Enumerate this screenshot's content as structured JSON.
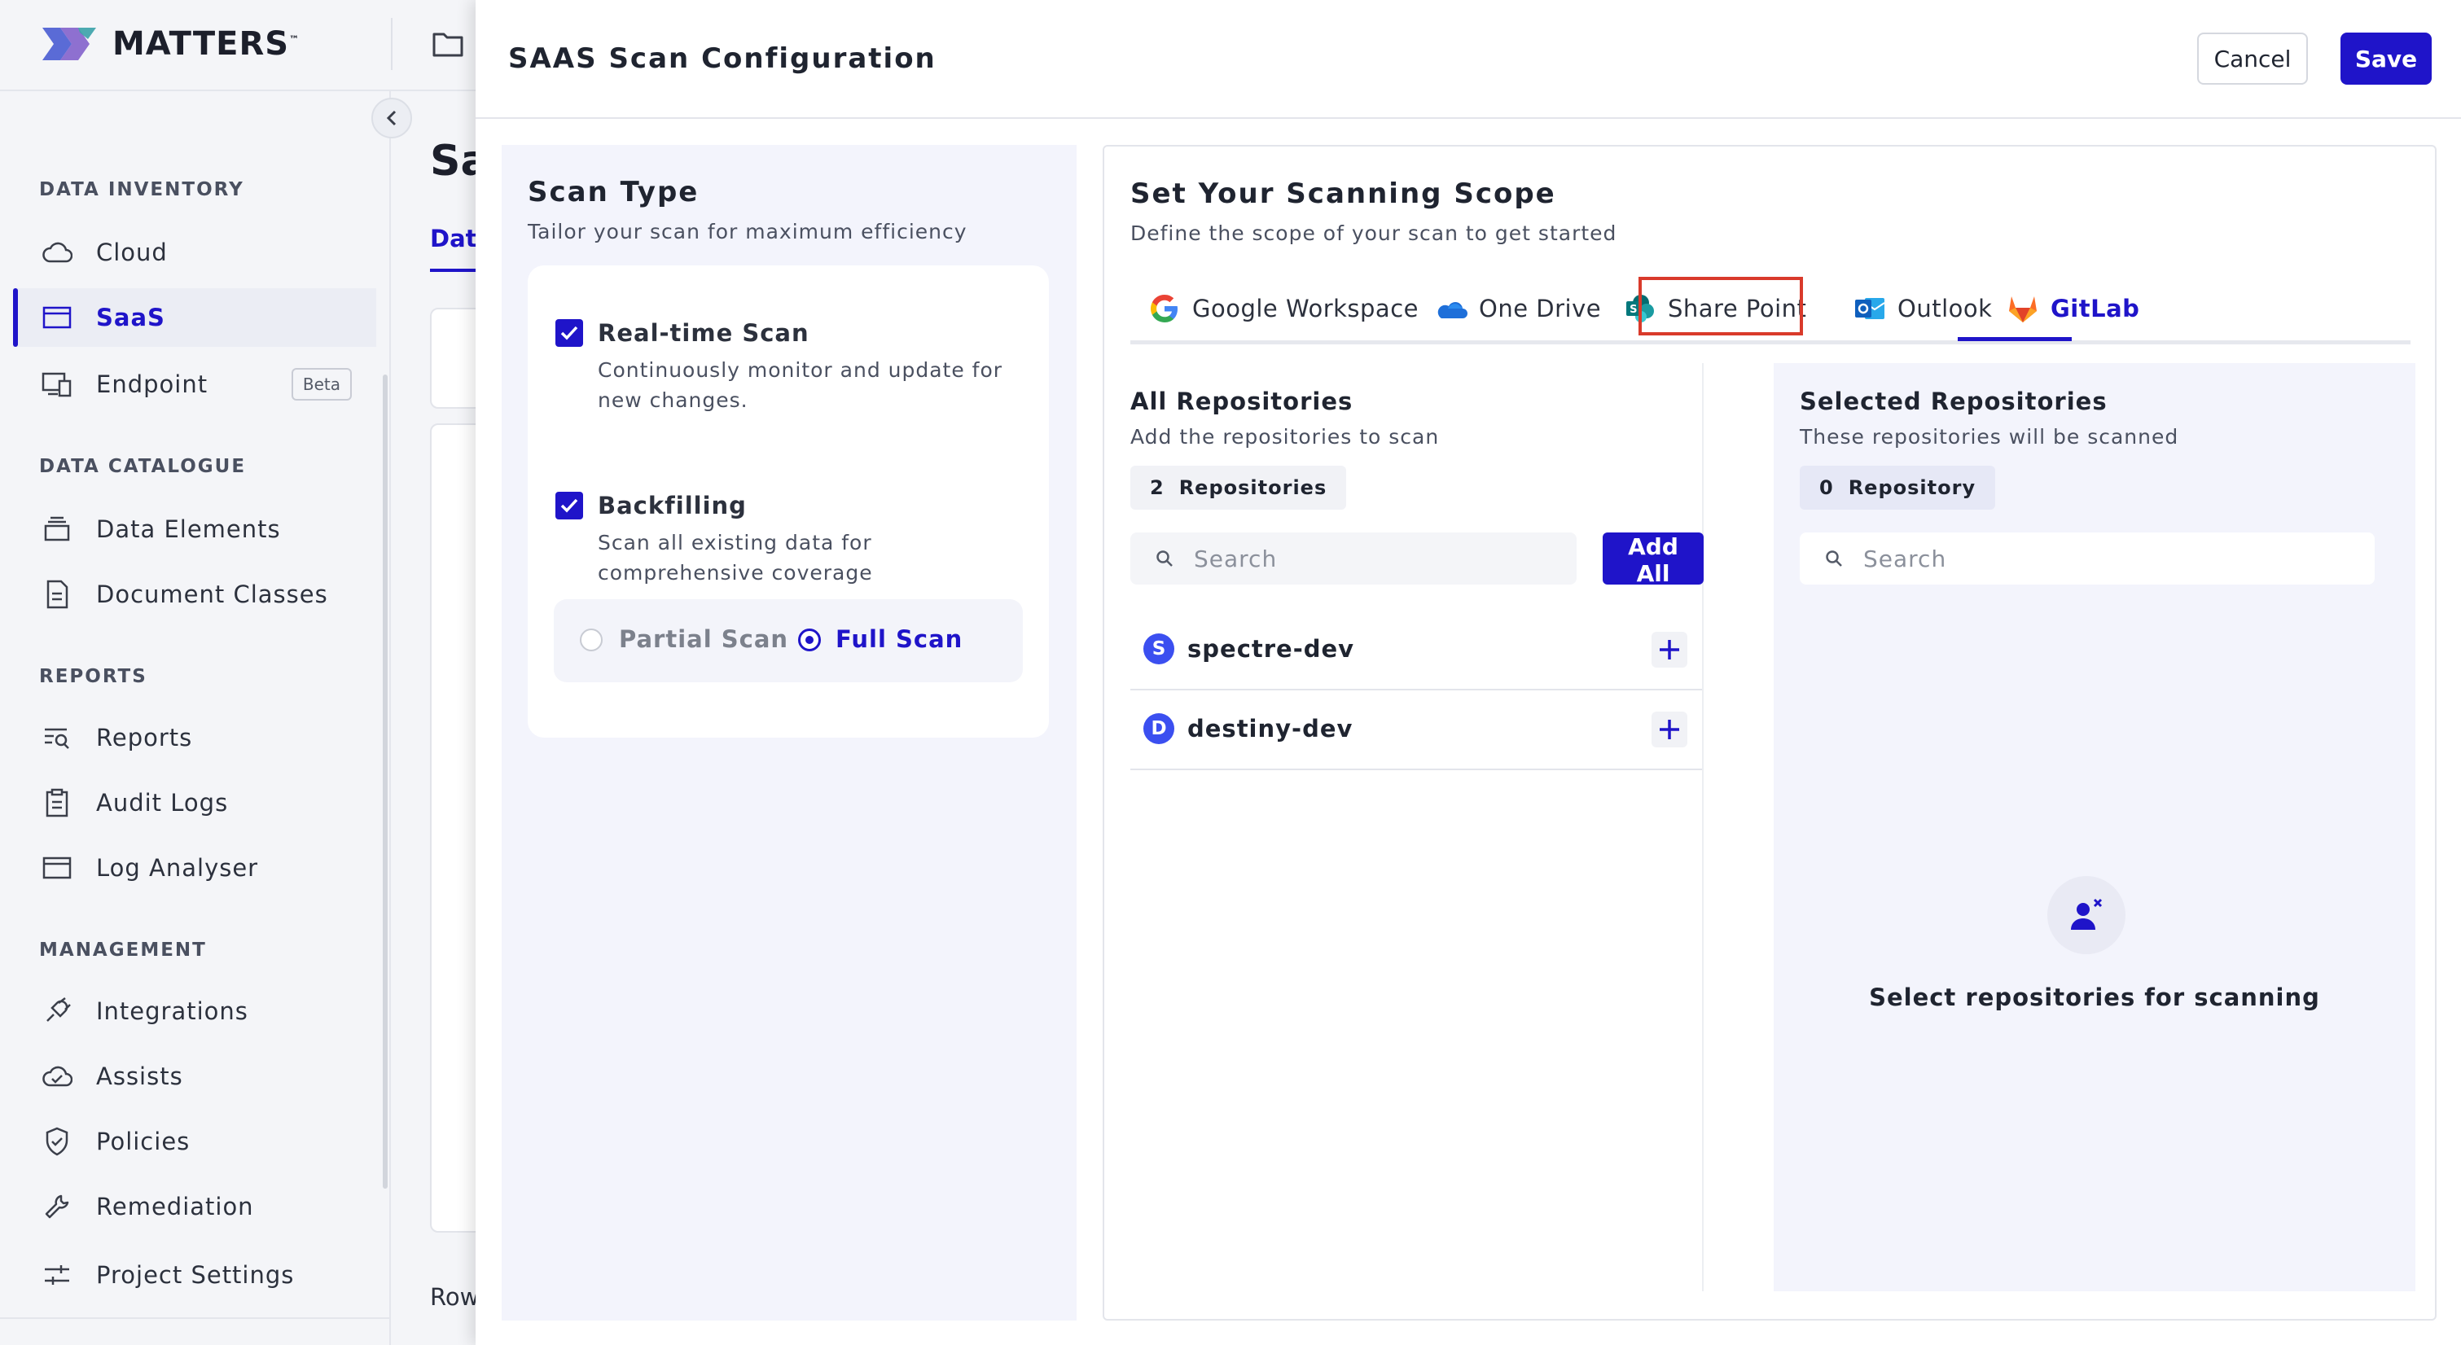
{
  "app": {
    "logo_text": "MATTERS",
    "logo_mark": "™",
    "peek_title": "Sa",
    "peek_tab": "Data",
    "peek_rows_label": "Row"
  },
  "sidebar": {
    "sections": [
      {
        "title": "DATA INVENTORY",
        "items": [
          {
            "label": "Cloud",
            "icon": "cloud-icon"
          },
          {
            "label": "SaaS",
            "icon": "window-icon",
            "active": true
          },
          {
            "label": "Endpoint",
            "icon": "devices-icon",
            "badge": "Beta"
          }
        ]
      },
      {
        "title": "DATA CATALOGUE",
        "items": [
          {
            "label": "Data Elements",
            "icon": "stack-icon"
          },
          {
            "label": "Document Classes",
            "icon": "document-icon"
          }
        ]
      },
      {
        "title": "REPORTS",
        "items": [
          {
            "label": "Reports",
            "icon": "report-search-icon"
          },
          {
            "label": "Audit Logs",
            "icon": "clipboard-icon"
          },
          {
            "label": "Log Analyser",
            "icon": "window-icon"
          }
        ]
      },
      {
        "title": "MANAGEMENT",
        "items": [
          {
            "label": "Integrations",
            "icon": "plug-icon"
          },
          {
            "label": "Assists",
            "icon": "cloud-check-icon"
          },
          {
            "label": "Policies",
            "icon": "shield-check-icon"
          },
          {
            "label": "Remediation",
            "icon": "wrench-icon"
          }
        ]
      }
    ],
    "footer_item": {
      "label": "Project Settings",
      "icon": "sliders-icon"
    }
  },
  "modal": {
    "title": "SAAS Scan Configuration",
    "cancel_label": "Cancel",
    "save_label": "Save",
    "scan_type": {
      "title": "Scan Type",
      "subtitle": "Tailor your scan for maximum efficiency",
      "options": [
        {
          "title": "Real-time Scan",
          "description": "Continuously monitor and update for new changes.",
          "checked": true
        },
        {
          "title": "Backfilling",
          "description": "Scan all existing data for comprehensive coverage",
          "checked": true
        }
      ],
      "modes": [
        {
          "label": "Partial Scan",
          "selected": false
        },
        {
          "label": "Full Scan",
          "selected": true
        }
      ]
    },
    "scope": {
      "title": "Set Your Scanning Scope",
      "subtitle": "Define the scope of your scan to get started",
      "tabs": [
        {
          "label": "Google Workspace",
          "icon": "google-icon"
        },
        {
          "label": "One Drive",
          "icon": "onedrive-icon"
        },
        {
          "label": "Share Point",
          "icon": "sharepoint-icon"
        },
        {
          "label": "Outlook",
          "icon": "outlook-icon"
        },
        {
          "label": "GitLab",
          "icon": "gitlab-icon",
          "active": true
        }
      ],
      "all_repos": {
        "title": "All Repositories",
        "subtitle": "Add the repositories to scan",
        "count": "2",
        "count_label": "Repositories",
        "search_placeholder": "Search",
        "add_all_label": "Add All",
        "items": [
          {
            "initial": "S",
            "name": "spectre-dev"
          },
          {
            "initial": "D",
            "name": "destiny-dev"
          }
        ]
      },
      "selected_repos": {
        "title": "Selected Repositories",
        "subtitle": "These repositories will be scanned",
        "count": "0",
        "count_label": "Repository",
        "search_placeholder": "Search",
        "empty_text": "Select repositories for scanning"
      }
    }
  },
  "colors": {
    "accent": "#1f14c9",
    "highlight": "#d93a2b",
    "panel_bg": "#f3f4fc"
  }
}
